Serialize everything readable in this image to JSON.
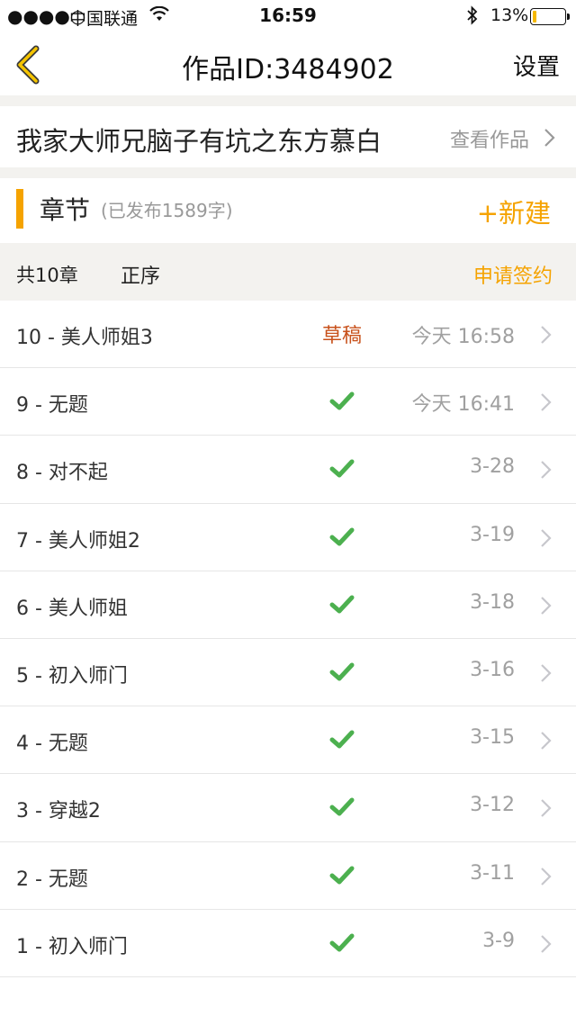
{
  "status_bar": {
    "signal": "●●●●○",
    "carrier": "中国联通",
    "time": "16:59",
    "battery_percent": "13%",
    "battery_level": 0.13,
    "battery_color": "#f5b800"
  },
  "nav": {
    "back_icon": "chevron-left-icon",
    "title": "作品ID:3484902",
    "settings_label": "设置"
  },
  "work": {
    "title": "我家大师兄脑子有坑之东方慕白",
    "view_label": "查看作品"
  },
  "chapters_header": {
    "label": "章节",
    "published": "(已发布1589字)",
    "new_label": "+新建"
  },
  "toolbar": {
    "count": "共10章",
    "order": "正序",
    "sign_label": "申请签约"
  },
  "colors": {
    "accent": "#f5a300",
    "draft": "#c8511b",
    "published_check": "#4cb04f"
  },
  "chapters": [
    {
      "name": "10 - 美人师姐3",
      "status": "draft",
      "status_label": "草稿",
      "time": "今天 16:58"
    },
    {
      "name": "9 - 无题",
      "status": "published",
      "status_label": "",
      "time": "今天 16:41"
    },
    {
      "name": "8 - 对不起",
      "status": "published",
      "status_label": "",
      "time": "3-28"
    },
    {
      "name": "7 - 美人师姐2",
      "status": "published",
      "status_label": "",
      "time": "3-19"
    },
    {
      "name": "6 - 美人师姐",
      "status": "published",
      "status_label": "",
      "time": "3-18"
    },
    {
      "name": "5 - 初入师门",
      "status": "published",
      "status_label": "",
      "time": "3-16"
    },
    {
      "name": "4 - 无题",
      "status": "published",
      "status_label": "",
      "time": "3-15"
    },
    {
      "name": "3 - 穿越2",
      "status": "published",
      "status_label": "",
      "time": "3-12"
    },
    {
      "name": "2 - 无题",
      "status": "published",
      "status_label": "",
      "time": "3-11"
    },
    {
      "name": "1 - 初入师门",
      "status": "published",
      "status_label": "",
      "time": "3-9"
    }
  ]
}
